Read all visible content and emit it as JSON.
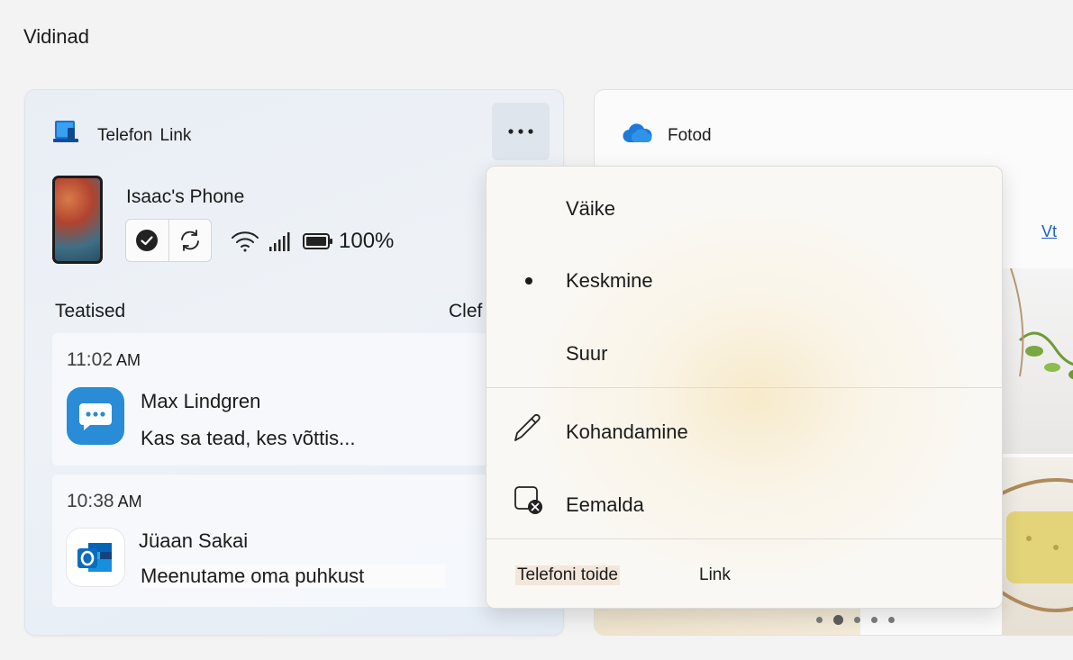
{
  "page": {
    "title": "Vidinad"
  },
  "phone_widget": {
    "app_name": "Telefon Link",
    "device_name": "Isaac's Phone",
    "battery": "100%",
    "notifications_heading": "Teatised",
    "clear_label": "Clef",
    "notifications": [
      {
        "time": "11:02",
        "ampm": "AM",
        "sender": "Max Lindgren",
        "preview": "Kas sa tead, kes võttis...",
        "app": "messages"
      },
      {
        "time": "10:38",
        "ampm": "AM",
        "sender": "Jüaan Sakai",
        "preview": "Meenutame oma puhkust",
        "app": "outlook"
      }
    ]
  },
  "photos_widget": {
    "app_name": "Fotod",
    "link": "Vt"
  },
  "context_menu": {
    "size_small": "Väike",
    "size_medium": "Keskmine",
    "size_large": "Suur",
    "selected_size": "Keskmine",
    "customize": "Kohandamine",
    "remove": "Eemalda",
    "footer_left": "Telefoni toide",
    "footer_right": "Link"
  },
  "colors": {
    "accent_blue": "#2a8cd6",
    "link_blue": "#1f5fbf",
    "outlook_blue": "#0f6cbd"
  }
}
